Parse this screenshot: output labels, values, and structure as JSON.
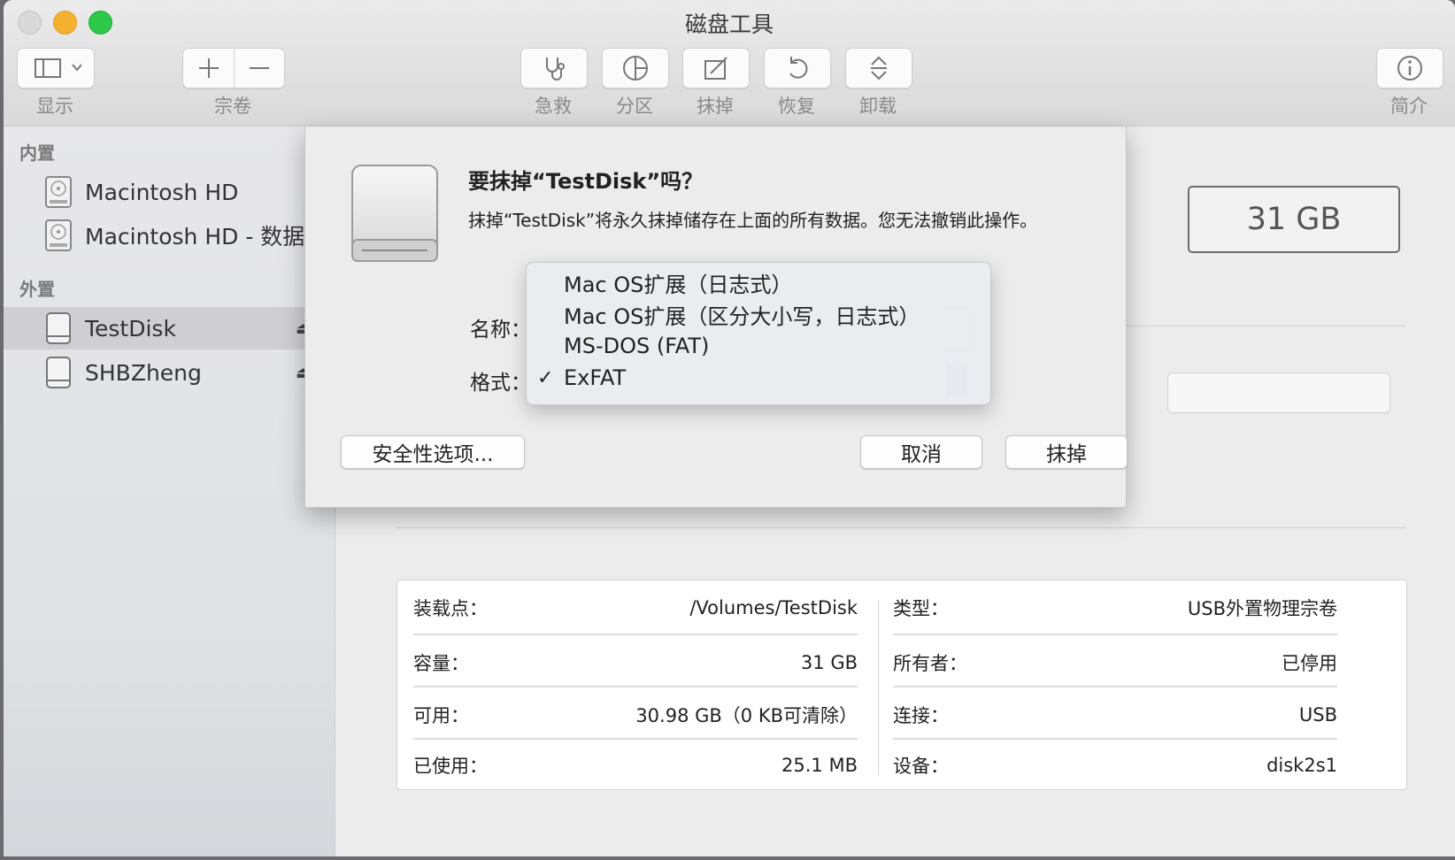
{
  "window": {
    "title": "磁盘工具"
  },
  "toolbar": {
    "view_label": "显示",
    "volume_label": "宗卷",
    "first_aid_label": "急救",
    "partition_label": "分区",
    "erase_label": "抹掉",
    "restore_label": "恢复",
    "unmount_label": "卸载",
    "info_label": "简介"
  },
  "sidebar": {
    "internal_title": "内置",
    "external_title": "外置",
    "internal_items": [
      {
        "label": "Macintosh HD"
      },
      {
        "label": "Macintosh HD - 数据"
      }
    ],
    "external_items": [
      {
        "label": "TestDisk",
        "selected": true
      },
      {
        "label": "SHBZheng",
        "selected": false
      }
    ]
  },
  "main": {
    "capacity": "31 GB",
    "info": {
      "left": [
        {
          "key": "装载点：",
          "value": "/Volumes/TestDisk"
        },
        {
          "key": "容量：",
          "value": "31 GB"
        },
        {
          "key": "可用：",
          "value": "30.98 GB（0 KB可清除）"
        },
        {
          "key": "已使用：",
          "value": "25.1 MB"
        }
      ],
      "right": [
        {
          "key": "类型：",
          "value": "USB外置物理宗卷"
        },
        {
          "key": "所有者：",
          "value": "已停用"
        },
        {
          "key": "连接：",
          "value": "USB"
        },
        {
          "key": "设备：",
          "value": "disk2s1"
        }
      ]
    }
  },
  "dialog": {
    "title": "要抹掉“TestDisk”吗？",
    "message": "抹掉“TestDisk”将永久抹掉储存在上面的所有数据。您无法撤销此操作。",
    "name_label": "名称：",
    "format_label": "格式：",
    "security_button": "安全性选项...",
    "cancel_button": "取消",
    "erase_button": "抹掉"
  },
  "format_menu": {
    "selected": "ExFAT",
    "options": [
      "Mac OS扩展（日志式）",
      "Mac OS扩展（区分大小写，日志式）",
      "MS-DOS (FAT)",
      "ExFAT"
    ]
  },
  "colors": {
    "accent": "#2b6fdc",
    "selection": "#cfcfd2"
  }
}
